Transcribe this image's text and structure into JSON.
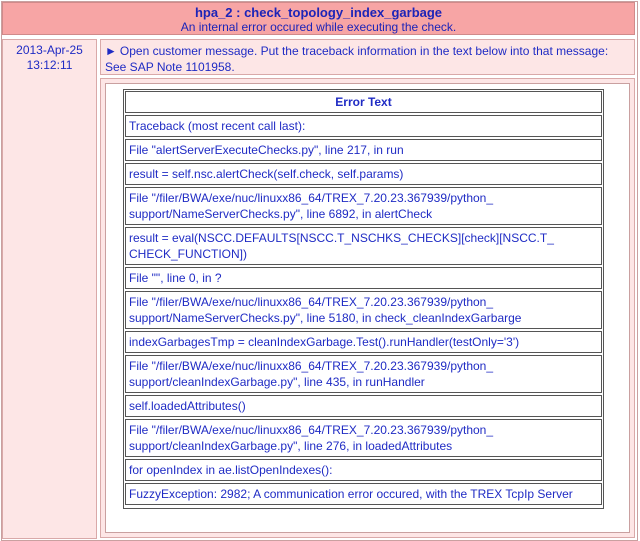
{
  "header": {
    "title": "hpa_2 : check_topology_index_garbage",
    "subtitle": "An internal error occured while executing the check."
  },
  "entry": {
    "date": "2013-Apr-25",
    "time": "13:12:11",
    "message_arrow": "►",
    "message": "Open customer message. Put the traceback information in the text below into that message: See SAP Note 1101958."
  },
  "error_table": {
    "heading": "Error Text",
    "rows": [
      "Traceback (most recent call last):",
      "File \"alertServerExecuteChecks.py\", line 217, in run",
      "result = self.nsc.alertCheck(self.check, self.params)",
      "File \"/filer/BWA/exe/nuc/linuxx86_64/TREX_7.20.23.367939/python_ support/NameServerChecks.py\", line 6892, in alertCheck",
      "result = eval(NSCC.DEFAULTS[NSCC.T_NSCHKS_CHECKS][check][NSCC.T_ CHECK_FUNCTION])",
      "File \"\", line 0, in ?",
      "File \"/filer/BWA/exe/nuc/linuxx86_64/TREX_7.20.23.367939/python_ support/NameServerChecks.py\", line 5180, in check_cleanIndexGarbarge",
      "indexGarbagesTmp = cleanIndexGarbage.Test().runHandler(testOnly='3')",
      "File \"/filer/BWA/exe/nuc/linuxx86_64/TREX_7.20.23.367939/python_ support/cleanIndexGarbage.py\", line 435, in runHandler",
      "self.loadedAttributes()",
      "File \"/filer/BWA/exe/nuc/linuxx86_64/TREX_7.20.23.367939/python_ support/cleanIndexGarbage.py\", line 276, in loadedAttributes",
      "for openIndex in ae.listOpenIndexes():",
      "FuzzyException: 2982; A communication error occured, with the TREX TcpIp Server"
    ]
  },
  "colors": {
    "header_bg": "#f7a5a5",
    "cell_bg": "#fde6e6",
    "text": "#1f2bc4"
  }
}
